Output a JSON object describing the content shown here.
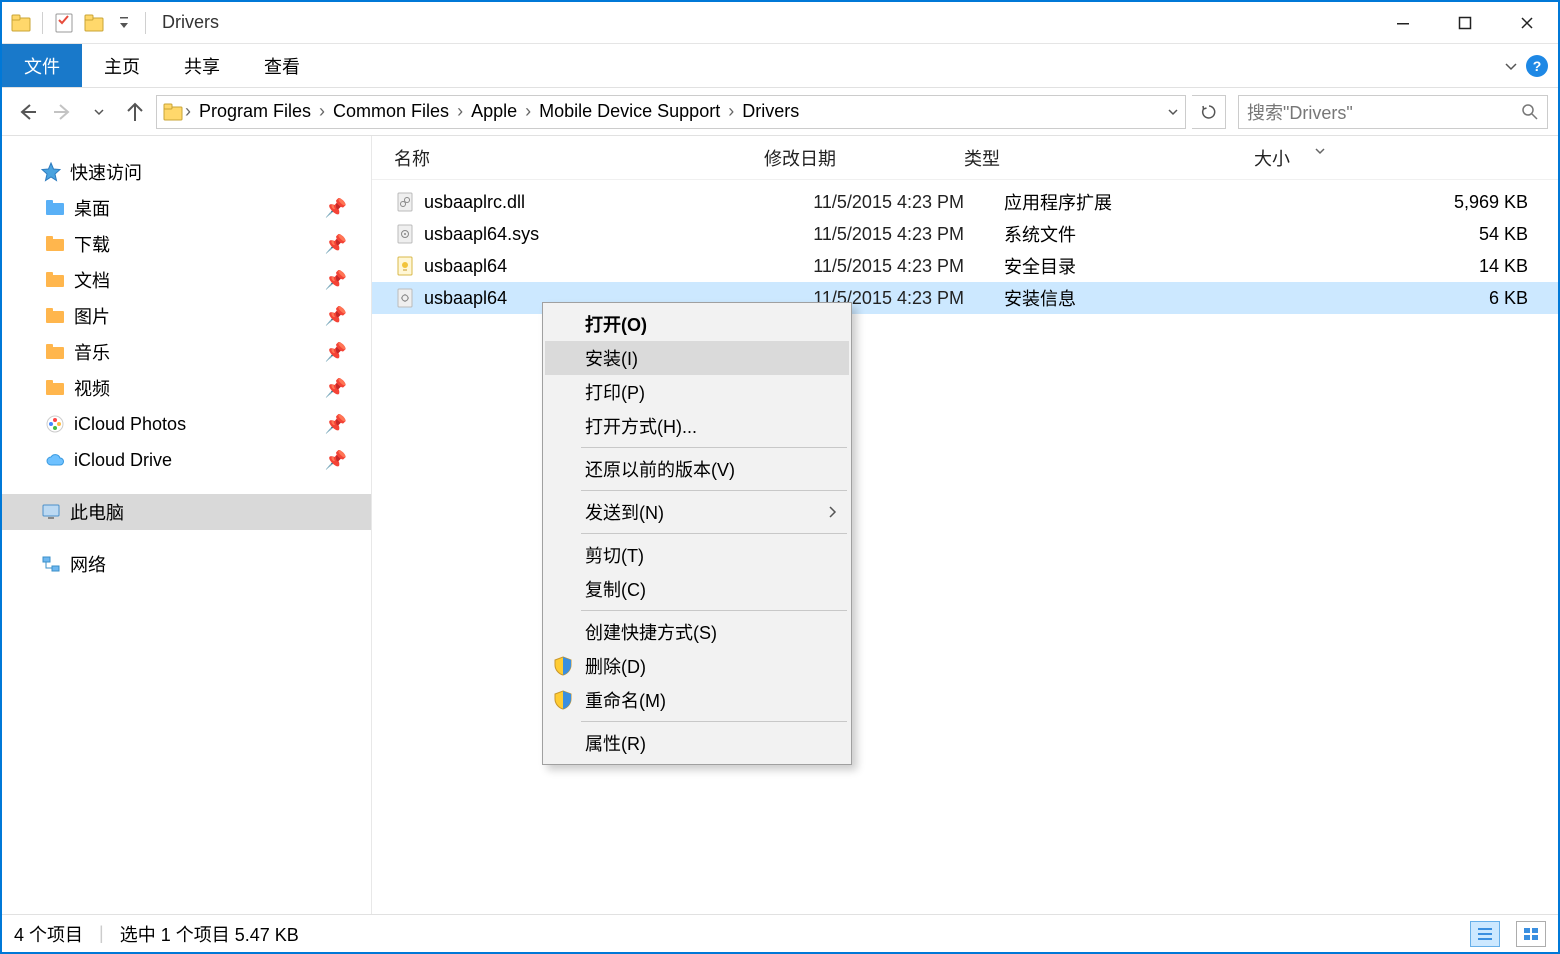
{
  "window": {
    "title": "Drivers"
  },
  "ribbon": {
    "file": "文件",
    "home": "主页",
    "share": "共享",
    "view": "查看"
  },
  "breadcrumb": {
    "items": [
      "Program Files",
      "Common Files",
      "Apple",
      "Mobile Device Support",
      "Drivers"
    ]
  },
  "search": {
    "placeholder": "搜索\"Drivers\""
  },
  "sidebar": {
    "quick_access": "快速访问",
    "items": [
      {
        "label": "桌面"
      },
      {
        "label": "下载"
      },
      {
        "label": "文档"
      },
      {
        "label": "图片"
      },
      {
        "label": "音乐"
      },
      {
        "label": "视频"
      },
      {
        "label": "iCloud Photos"
      },
      {
        "label": "iCloud Drive"
      }
    ],
    "this_pc": "此电脑",
    "network": "网络"
  },
  "columns": {
    "name": "名称",
    "date": "修改日期",
    "type": "类型",
    "size": "大小"
  },
  "files": [
    {
      "name": "usbaaplrc.dll",
      "date": "11/5/2015 4:23 PM",
      "type": "应用程序扩展",
      "size": "5,969 KB"
    },
    {
      "name": "usbaapl64.sys",
      "date": "11/5/2015 4:23 PM",
      "type": "系统文件",
      "size": "54 KB"
    },
    {
      "name": "usbaapl64",
      "date": "11/5/2015 4:23 PM",
      "type": "安全目录",
      "size": "14 KB"
    },
    {
      "name": "usbaapl64",
      "date": "11/5/2015 4:23 PM",
      "type": "安装信息",
      "size": "6 KB"
    }
  ],
  "context_menu": {
    "open": "打开(O)",
    "install": "安装(I)",
    "print": "打印(P)",
    "open_with": "打开方式(H)...",
    "restore": "还原以前的版本(V)",
    "send_to": "发送到(N)",
    "cut": "剪切(T)",
    "copy": "复制(C)",
    "shortcut": "创建快捷方式(S)",
    "delete": "删除(D)",
    "rename": "重命名(M)",
    "properties": "属性(R)"
  },
  "statusbar": {
    "count": "4 个项目",
    "selection": "选中 1 个项目 5.47 KB"
  }
}
